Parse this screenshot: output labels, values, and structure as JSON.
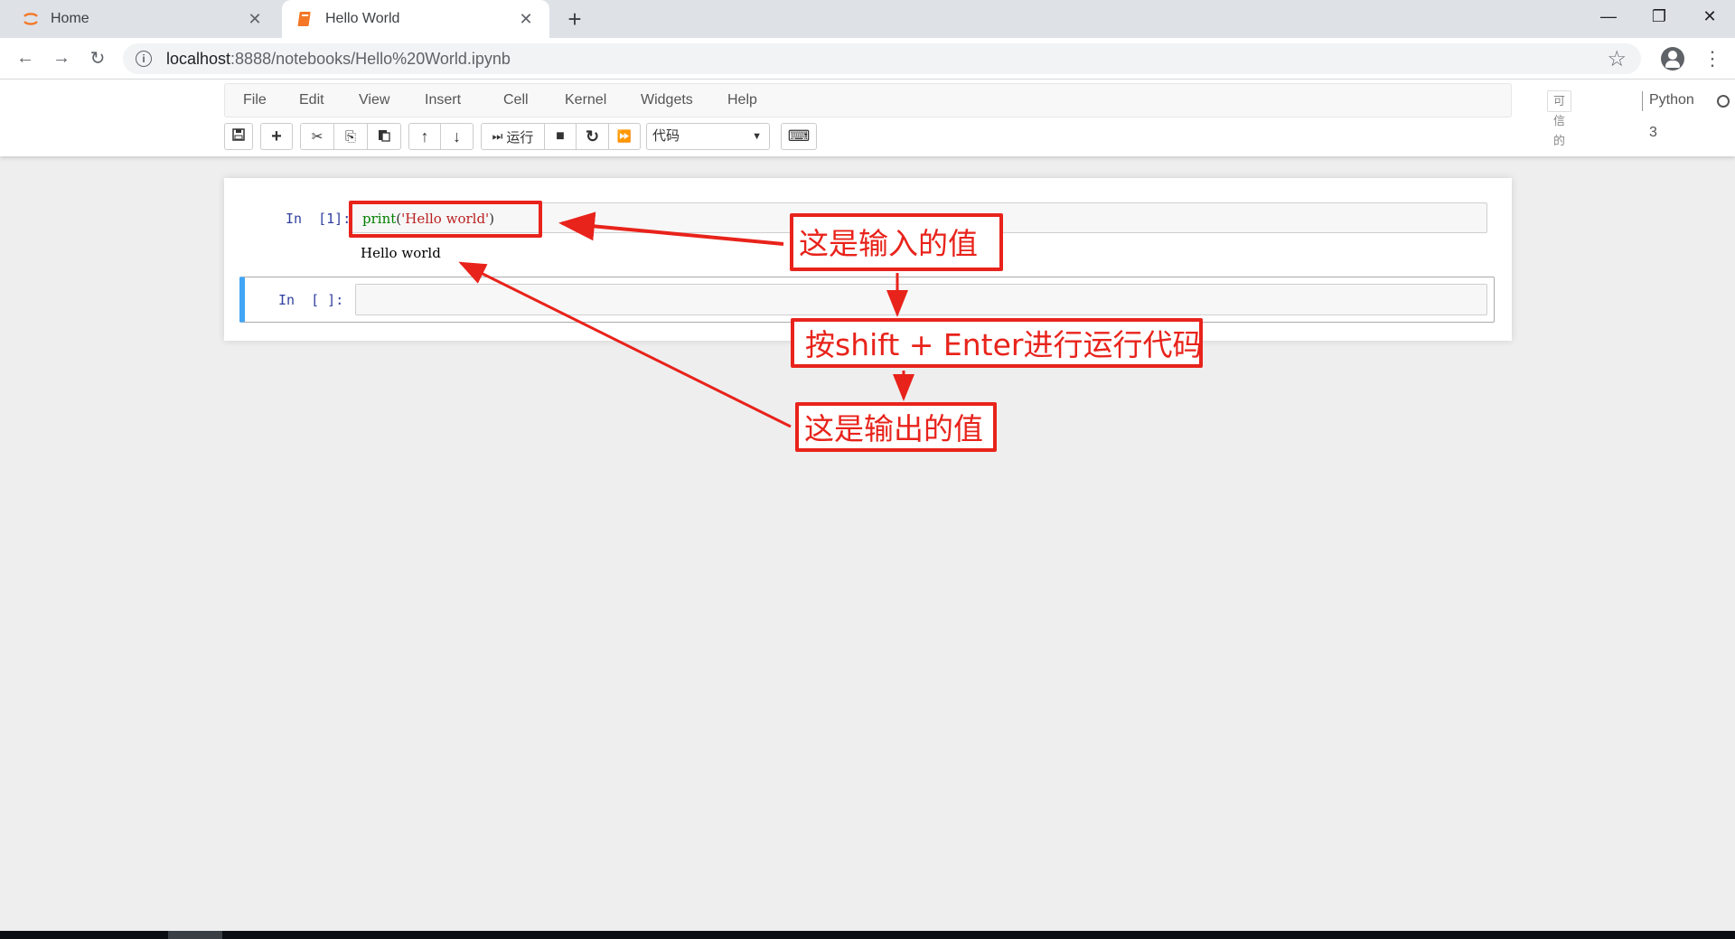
{
  "browser": {
    "tabs": [
      {
        "title": "Home",
        "close": "✕"
      },
      {
        "title": "Hello World",
        "close": "✕"
      }
    ],
    "new_tab": "+",
    "window_controls": {
      "minimize": "—",
      "restore": "❐",
      "close": "✕"
    },
    "nav": {
      "back": "←",
      "forward": "→",
      "reload": "↻"
    },
    "url_host": "localhost",
    "url_path": ":8888/notebooks/Hello%20World.ipynb",
    "star": "☆",
    "menu": "⋮"
  },
  "jupyter": {
    "menu": [
      "File",
      "Edit",
      "View",
      "Insert",
      "Cell",
      "Kernel",
      "Widgets",
      "Help"
    ],
    "trusted": "可信的",
    "kernel": "Python 3",
    "toolbar": {
      "save": "🖫",
      "add": "+",
      "cut": "✂",
      "copy": "⎘",
      "paste": "📋",
      "up": "↑",
      "down": "↓",
      "run_icon": "⏭",
      "run_label": "运行",
      "stop": "■",
      "restart": "↻",
      "fast_forward": "⏩",
      "cell_type": "代码",
      "cell_type_caret": "▼",
      "keyboard": "⌨"
    }
  },
  "cells": [
    {
      "prompt": "In  [1]:",
      "code_fn": "print",
      "code_open": "(",
      "code_str": "'Hello world'",
      "code_close": ")",
      "output": "Hello world"
    },
    {
      "prompt": "In  [ ]:"
    }
  ],
  "annotations": {
    "input_label": "这是输入的值",
    "run_label": "按shift + Enter进行运行代码",
    "output_label": "这是输出的值",
    "color": "#e8231b"
  },
  "colors": {
    "selected_cell_bar": "#42a5f5",
    "prompt": "#303f9f"
  }
}
